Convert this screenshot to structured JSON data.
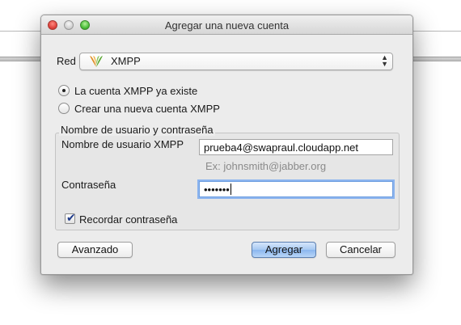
{
  "window": {
    "title": "Agregar una nueva cuenta",
    "controls": {
      "close": "close-button",
      "minimize": "minimize-button",
      "zoom": "zoom-button"
    }
  },
  "network": {
    "label": "Red",
    "selected": "XMPP",
    "icon": "jabber-logo-icon"
  },
  "options": {
    "existing_account": "La cuenta XMPP ya existe",
    "new_account": "Crear una nueva cuenta XMPP",
    "selected": "existing_account"
  },
  "credentials": {
    "group_title": "Nombre de usuario y contraseña",
    "username_label": "Nombre de usuario XMPP",
    "username_value": "prueba4@swapraul.cloudapp.net",
    "username_hint": "Ex: johnsmith@jabber.org",
    "password_label": "Contraseña",
    "password_mask": "•••••••",
    "remember_label": "Recordar contraseña",
    "remember_checked": true
  },
  "buttons": {
    "advanced": "Avanzado",
    "add": "Agregar",
    "cancel": "Cancelar"
  }
}
